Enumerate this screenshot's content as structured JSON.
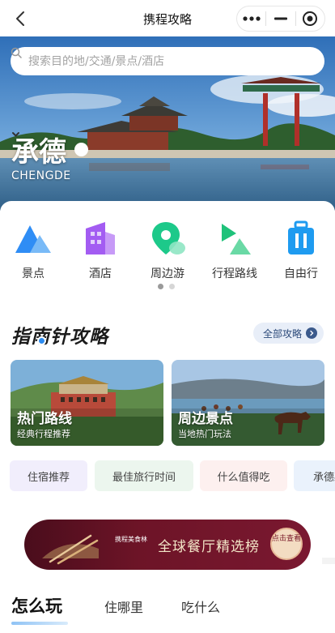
{
  "nav": {
    "title": "携程攻略"
  },
  "search": {
    "placeholder": "搜索目的地/交通/景点/酒店"
  },
  "hero": {
    "city": "承德",
    "city_en": "CHENGDE"
  },
  "categories": [
    {
      "label": "景点",
      "icon": "mountain-icon",
      "color": "#2f8df5"
    },
    {
      "label": "酒店",
      "icon": "building-icon",
      "color": "#a35cf2"
    },
    {
      "label": "周边游",
      "icon": "location-pin-icon",
      "color": "#1dc98a"
    },
    {
      "label": "行程路线",
      "icon": "route-flag-icon",
      "color": "#1fc27a"
    },
    {
      "label": "自由行",
      "icon": "suitcase-icon",
      "color": "#1e9bf0"
    }
  ],
  "guide": {
    "title": "指南针攻略",
    "all_label": "全部攻略",
    "features": [
      {
        "title": "热门路线",
        "subtitle": "经典行程推荐"
      },
      {
        "title": "周边景点",
        "subtitle": "当地热门玩法"
      }
    ],
    "chips": [
      {
        "label": "住宿推荐",
        "bg": "#f1eefc"
      },
      {
        "label": "最佳旅行时间",
        "bg": "#ecf6ee"
      },
      {
        "label": "什么值得吃",
        "bg": "#fdf0ef"
      },
      {
        "label": "承德必",
        "bg": "#eaf2fc"
      }
    ]
  },
  "banner": {
    "brand": "携程美食林",
    "headline": "全球餐厅精选榜",
    "cta": "点击查看"
  },
  "tabs": [
    {
      "label": "怎么玩",
      "active": true
    },
    {
      "label": "住哪里",
      "active": false
    },
    {
      "label": "吃什么",
      "active": false
    }
  ]
}
